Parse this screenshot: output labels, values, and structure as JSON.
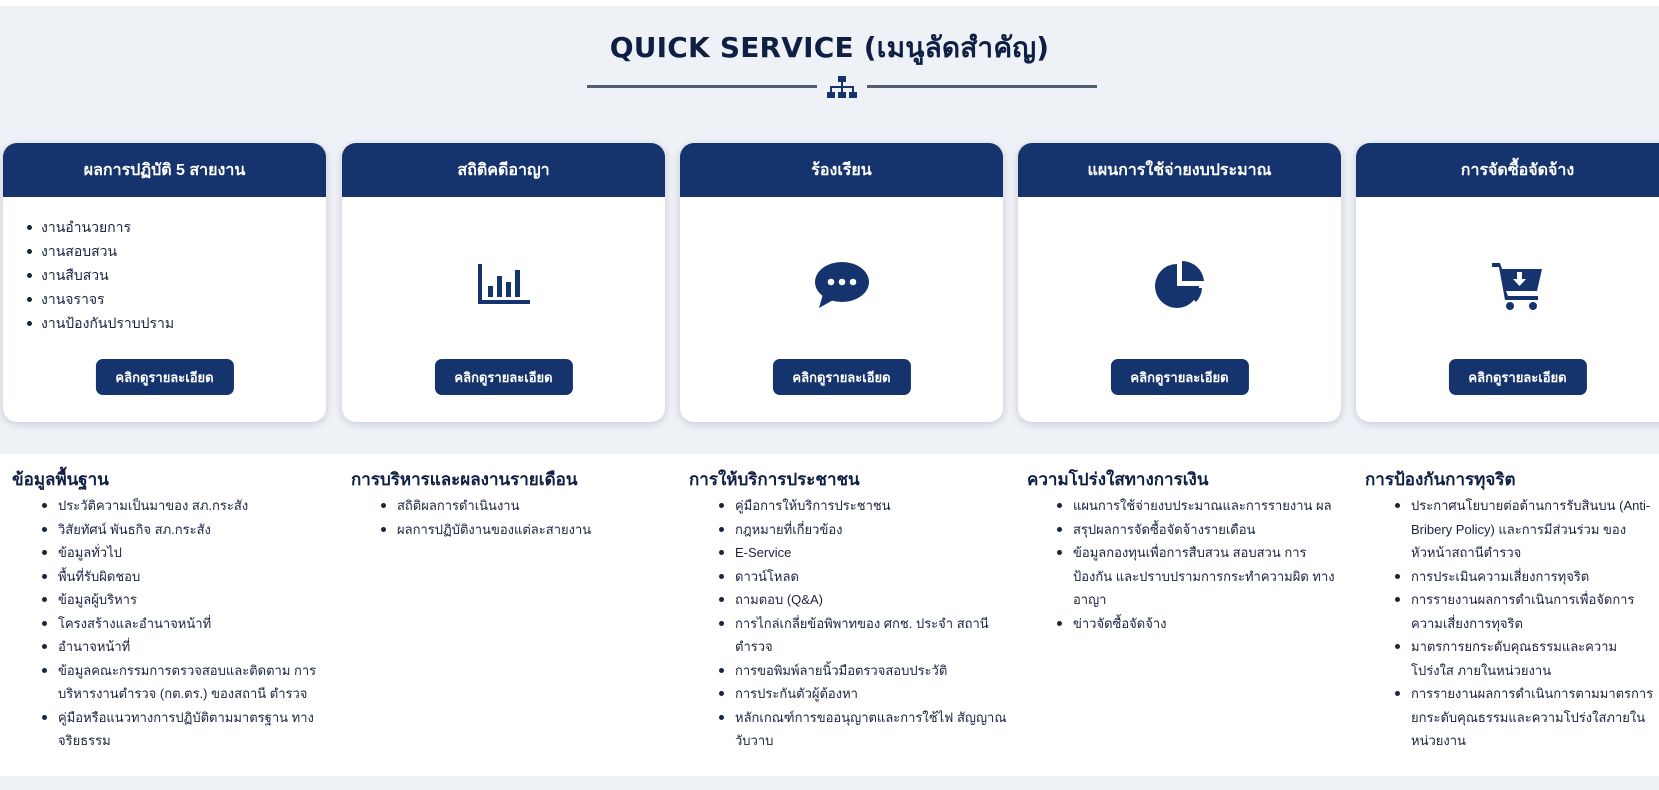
{
  "page": {
    "title": "QUICK SERVICE (เมนูลัดสำคัญ)",
    "divider_icon": "sitemap-icon"
  },
  "colors": {
    "header_bg": "#15336d",
    "accent": "#15336d",
    "band_bg": "#eef1f5",
    "text": "#1a2340"
  },
  "cards": [
    {
      "header": "ผลการปฏิบัติ 5 สายงาน",
      "items": [
        "งานอำนวยการ",
        "งานสอบสวน",
        "งานสืบสวน",
        "งานจราจร",
        "งานป้องกันปราบปราม"
      ],
      "button": "คลิกดูรายละเอียด"
    },
    {
      "header": "สถิติคดีอาญา",
      "icon": "bar-chart-icon",
      "button": "คลิกดูรายละเอียด"
    },
    {
      "header": "ร้องเรียน",
      "icon": "chat-bubble-icon",
      "button": "คลิกดูรายละเอียด"
    },
    {
      "header": "แผนการใช้จ่ายงบประมาณ",
      "icon": "pie-chart-icon",
      "button": "คลิกดูรายละเอียด"
    },
    {
      "header": "การจัดซื้อจัดจ้าง",
      "icon": "shopping-cart-icon",
      "button": "คลิกดูรายละเอียด"
    }
  ],
  "columns": [
    {
      "title": "ข้อมูลพื้นฐาน",
      "items": [
        "ประวัติความเป็นมาของ สภ.กระสัง",
        "วิสัยทัศน์ พันธกิจ สภ.กระสัง",
        "ข้อมูลทั่วไป",
        "พื้นที่รับผิดชอบ",
        "ข้อมูลผู้บริหาร",
        "โครงสร้างและอำนาจหน้าที่",
        "อำนาจหน้าที่",
        "ข้อมูลคณะกรรมการตรวจสอบและติดตาม การบริหารงานตำรวจ (กต.ตร.) ของสถานี ตำรวจ",
        "คู่มือหรือแนวทางการปฏิบัติตามมาตรฐาน ทางจริยธรรม"
      ]
    },
    {
      "title": "การบริหารและผลงานรายเดือน",
      "items": [
        "สถิติผลการดำเนินงาน",
        "ผลการปฏิบัติงานของแต่ละสายงาน"
      ]
    },
    {
      "title": "การให้บริการประชาชน",
      "items": [
        "คู่มือการให้บริการประชาชน",
        "กฎหมายที่เกี่ยวข้อง",
        "E-Service",
        "ดาวน์โหลด",
        "ถามตอบ (Q&A)",
        "การไกล่เกลี่ยข้อพิพาทของ ศกช. ประจำ สถานีตำรวจ",
        "การขอพิมพ์ลายนิ้วมือตรวจสอบประวัติ",
        "การประกันตัวผู้ต้องหา",
        "หลักเกณฑ์การขออนุญาตและการใช้ไฟ สัญญาณวับวาบ"
      ]
    },
    {
      "title": "ความโปร่งใสทางการเงิน",
      "items": [
        "แผนการใช้จ่ายงบประมาณและการรายงาน ผล",
        "สรุปผลการจัดซื้อจัดจ้างรายเดือน",
        "ข้อมูลกองทุนเพื่อการสืบสวน สอบสวน การ ป้องกัน และปราบปรามการกระทำความผิด ทางอาญา",
        "ข่าวจัดซื้อจัดจ้าง"
      ]
    },
    {
      "title": "การป้องกันการทุจริต",
      "items": [
        "ประกาศนโยบายต่อต้านการรับสินบน (Anti-Bribery Policy) และการมีส่วนร่วม ของหัวหน้าสถานีตำรวจ",
        "การประเมินความเสี่ยงการทุจริต",
        "การรายงานผลการดำเนินการเพื่อจัดการ ความเสี่ยงการทุจริต",
        "มาตรการยกระดับคุณธรรมและความโปร่งใส ภายในหน่วยงาน",
        "การรายงานผลการดำเนินการตามมาตรการ ยกระดับคุณธรรมและความโปร่งใสภายใน หน่วยงาน"
      ]
    }
  ]
}
